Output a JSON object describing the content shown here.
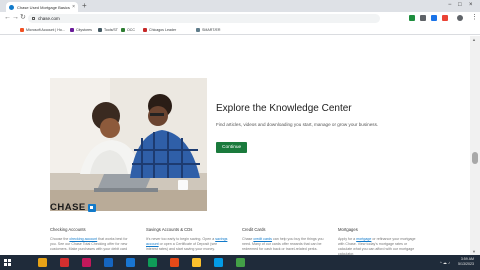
{
  "browser": {
    "tab_title": "Chase Used Mortgage Basics",
    "tab_close": "×",
    "new_tab": "+",
    "window_controls": {
      "minimize": "−",
      "maximize": "□",
      "close": "×"
    },
    "nav": {
      "back": "←",
      "forward": "→",
      "reload": "↻"
    },
    "url": "chase.com",
    "menu": "⋮",
    "bookmarks": [
      {
        "label": "Microsoft Account | Ho...",
        "color": "#f25022"
      },
      {
        "label": "Citystores",
        "color": "#6a1b9a"
      },
      {
        "label": "Tools/ST",
        "color": "#455a64"
      },
      {
        "label": "OCC",
        "color": "#2e7d32"
      },
      {
        "label": "Chicagos Leader",
        "color": "#c62828"
      },
      {
        "label": "SMART/ER",
        "color": "#607d8b"
      }
    ],
    "extension_colors": [
      "#1e8e3e",
      "#5f6368",
      "#1a73e8",
      "#ea4335",
      "#5f6368"
    ]
  },
  "hero": {
    "title": "Explore the Knowledge Center",
    "description": "Find articles, videos and downloading you start, manage or grow your business.",
    "button_label": "Continue"
  },
  "footer": {
    "logo_text": "CHASE",
    "brand_color": "#117aca",
    "columns": [
      {
        "title": "Checking Accounts",
        "pre": "Choose the ",
        "link": "checking account",
        "post": " that works best for you. See our Chase Total Checking offer for new customers. Make purchases with your debit card"
      },
      {
        "title": "Savings Accounts & CDs",
        "pre": "It's never too early to begin saving. Open a ",
        "link": "savings account",
        "post": " or open a Certificate of Deposit (see interest rates) and start saving your money."
      },
      {
        "title": "Credit Cards",
        "pre": "Chase ",
        "link": "credit cards",
        "post": " can help you buy the things you need. Many of our cards offer rewards that can be redeemed for cash back or travel-related perks."
      },
      {
        "title": "Mortgages",
        "pre": "Apply for a ",
        "link": "mortgage",
        "post": " or refinance your mortgage with Chase. View today's mortgage rates or calculate what you can afford with our mortgage calculator."
      }
    ]
  },
  "scrollbar": {
    "up": "▲",
    "down": "▼"
  },
  "taskbar": {
    "app_colors": [
      "#e8a317",
      "#d32f2f",
      "#c2185b",
      "#1565c0",
      "#1976d2",
      "#0f9d58",
      "#e64a19",
      "#fbc02d",
      "#039be5",
      "#43a047"
    ],
    "tray_icons": "^ ☁ ♪",
    "time": "3:59 AM",
    "date": "5/13/2023"
  }
}
